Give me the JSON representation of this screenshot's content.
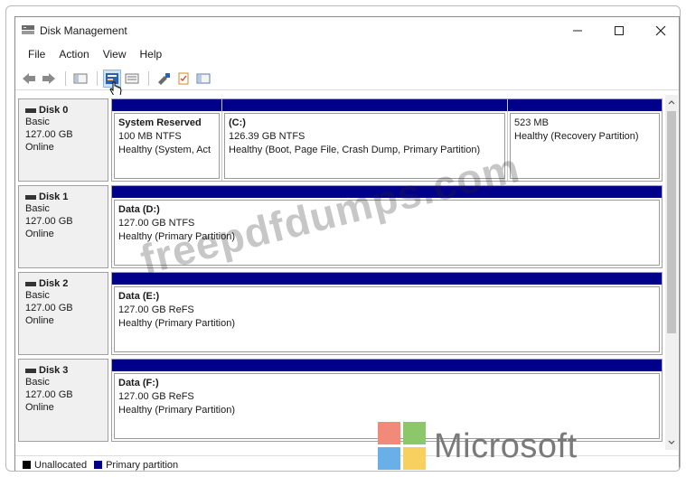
{
  "window": {
    "title": "Disk Management",
    "controls": {
      "minimize": "—",
      "maximize": "☐",
      "close": "✕"
    }
  },
  "menu": [
    {
      "label": "File"
    },
    {
      "label": "Action"
    },
    {
      "label": "View"
    },
    {
      "label": "Help"
    }
  ],
  "toolbar": {
    "icons": [
      "back-arrow-icon",
      "forward-arrow-icon",
      "console-tree-icon",
      "help-properties-icon",
      "disk-list-icon",
      "connect-icon",
      "checklist-icon",
      "panel-icon"
    ]
  },
  "disks": [
    {
      "name": "Disk 0",
      "type": "Basic",
      "size": "127.00 GB",
      "status": "Online",
      "partitions": [
        {
          "title": "System Reserved",
          "fs": "100 MB NTFS",
          "health": "Healthy (System, Act"
        },
        {
          "title": "(C:)",
          "fs": "126.39 GB NTFS",
          "health": "Healthy (Boot, Page File, Crash Dump, Primary Partition)"
        },
        {
          "title": "",
          "fs": "523 MB",
          "health": "Healthy (Recovery Partition)"
        }
      ]
    },
    {
      "name": "Disk 1",
      "type": "Basic",
      "size": "127.00 GB",
      "status": "Online",
      "partitions": [
        {
          "title": "Data  (D:)",
          "fs": "127.00 GB NTFS",
          "health": "Healthy (Primary Partition)"
        }
      ]
    },
    {
      "name": "Disk 2",
      "type": "Basic",
      "size": "127.00 GB",
      "status": "Online",
      "partitions": [
        {
          "title": "Data  (E:)",
          "fs": "127.00 GB ReFS",
          "health": "Healthy (Primary Partition)"
        }
      ]
    },
    {
      "name": "Disk 3",
      "type": "Basic",
      "size": "127.00 GB",
      "status": "Online",
      "partitions": [
        {
          "title": "Data  (F:)",
          "fs": "127.00 GB ReFS",
          "health": "Healthy (Primary Partition)"
        }
      ]
    }
  ],
  "legend": [
    {
      "label": "Unallocated",
      "color": "#000000"
    },
    {
      "label": "Primary partition",
      "color": "#00008b"
    }
  ],
  "colors": {
    "partition_bar": "#00008b",
    "unallocated": "#000000"
  },
  "watermark": "freepdfdumps.com",
  "logo": {
    "text": "Microsoft"
  }
}
